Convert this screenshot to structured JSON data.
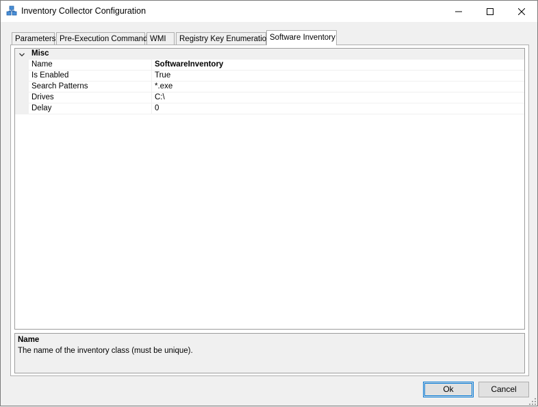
{
  "window": {
    "title": "Inventory Collector Configuration",
    "icon": "inventory-app-icon"
  },
  "tabs": [
    {
      "label": "Parameters",
      "active": false
    },
    {
      "label": "Pre-Execution Commands",
      "active": false
    },
    {
      "label": "WMI",
      "active": false
    },
    {
      "label": "Registry Key Enumeration",
      "active": false
    },
    {
      "label": "Software Inventory",
      "active": true
    }
  ],
  "property_grid": {
    "category": "Misc",
    "properties": [
      {
        "name": "Name",
        "value": "SoftwareInventory",
        "bold": true
      },
      {
        "name": "Is Enabled",
        "value": "True"
      },
      {
        "name": "Search Patterns",
        "value": "*.exe"
      },
      {
        "name": "Drives",
        "value": "C:\\"
      },
      {
        "name": "Delay",
        "value": "0"
      }
    ]
  },
  "help": {
    "title": "Name",
    "description": "The name of the inventory class (must be unique)."
  },
  "buttons": {
    "ok": "Ok",
    "cancel": "Cancel"
  },
  "colors": {
    "accent": "#0078d7",
    "category_bg": "#f0f0f0"
  }
}
